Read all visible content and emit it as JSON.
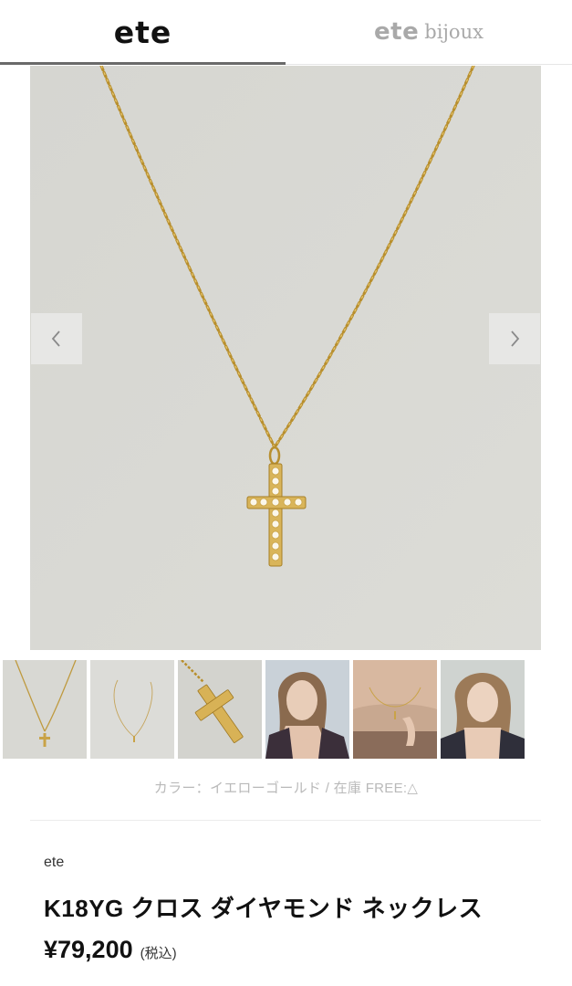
{
  "tabs": [
    {
      "label": "ete",
      "suffix": "",
      "active": true
    },
    {
      "label": "ete",
      "suffix": "bijoux",
      "active": false
    }
  ],
  "gallery": {
    "prev_icon": "chevron-left-icon",
    "next_icon": "chevron-right-icon",
    "thumbnail_count": 6
  },
  "product": {
    "meta_line": "カラー：イエローゴールド / 在庫 FREE:△",
    "brand": "ete",
    "name": "K18YG クロス ダイヤモンド ネックレス",
    "price": "¥79,200",
    "tax_note": "(税込)"
  },
  "colors": {
    "gold": "#c9a347",
    "photo_background": "#d9d9d4",
    "active_tab_underline": "#6a6a6a",
    "muted_text": "#b9b9b9"
  }
}
